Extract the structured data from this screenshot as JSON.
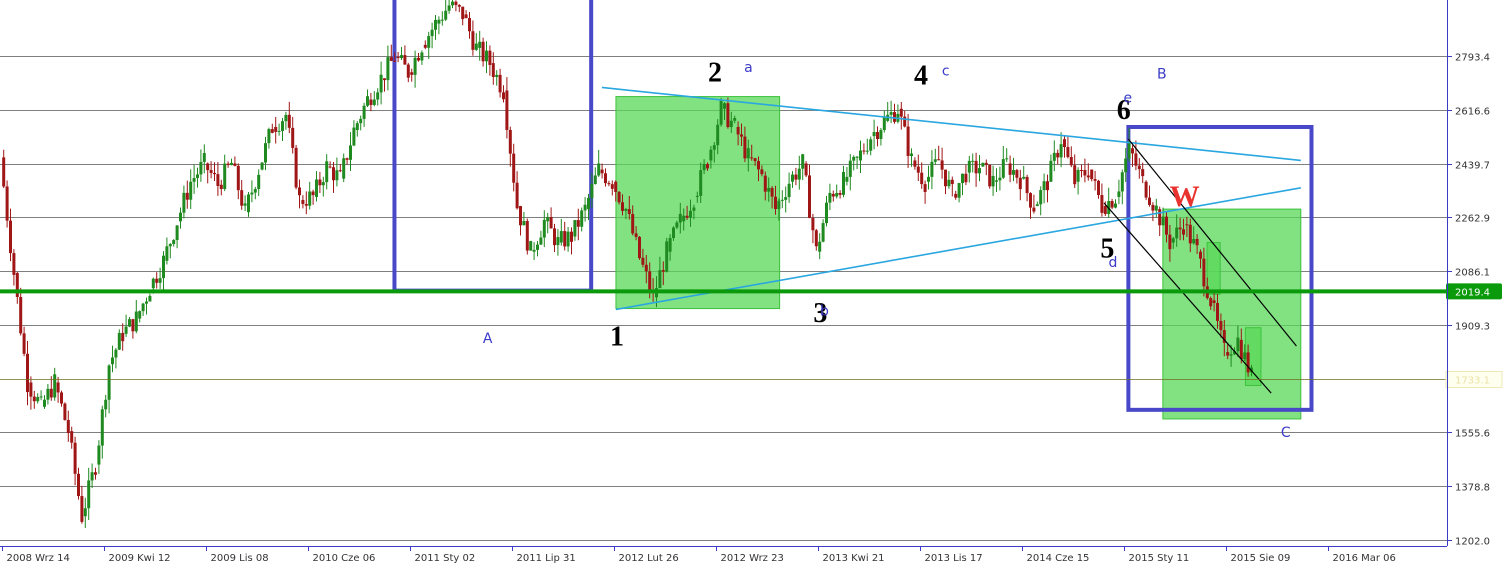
{
  "chart_data": {
    "type": "candlestick",
    "title": "",
    "xlabel": "",
    "ylabel": "",
    "ylim": [
      1202.0,
      3000.0
    ],
    "grid": true,
    "y_ticks": [
      "2793.4",
      "2616.6",
      "2439.7",
      "2262.9",
      "2086.1",
      "1909.3",
      "1555.6",
      "1378.8",
      "1202.0"
    ],
    "x_ticks": [
      "2008 Wrz 14",
      "2009 Kwi 12",
      "2009 Lis 08",
      "2010 Cze 06",
      "2011 Sty 02",
      "2011 Lip 31",
      "2012 Lut 26",
      "2012 Wrz 23",
      "2013 Kwi 21",
      "2013 Lis 17",
      "2014 Cze 15",
      "2015 Sty 11",
      "2015 Sie 09",
      "2016 Mar 06"
    ],
    "support_level": {
      "value": 2019.4,
      "label": "2019.4",
      "color": "#0b9a0b"
    },
    "last_price_level": {
      "value": 1733.0,
      "label": "1733.1"
    },
    "colors": {
      "up": "#1f8a1f",
      "down": "#a01515",
      "trendline": "#2aa6e0",
      "box": "#4848c8",
      "zone": "#58d858"
    },
    "waves": [
      {
        "label": "1",
        "date": "2012 Mar 01",
        "price": 1979
      },
      {
        "label": "2",
        "date": "2012 Sep 23",
        "price": 2650
      },
      {
        "label": "3",
        "date": "2013 Apr 28",
        "price": 2070
      },
      {
        "label": "4",
        "date": "2013 Nov 17",
        "price": 2640
      },
      {
        "label": "5",
        "date": "2014 Dec 14",
        "price": 2250
      },
      {
        "label": "6",
        "date": "2015 Jan 25",
        "price": 2520
      }
    ],
    "wave_letters": [
      "a",
      "b",
      "c",
      "d",
      "e",
      "A",
      "B",
      "C"
    ],
    "wave_w": "W",
    "series": [
      {
        "points": [
          [
            "2008 Sep 14",
            2460
          ],
          [
            "2008 Oct 12",
            2080
          ],
          [
            "2008 Nov 09",
            1720
          ],
          [
            "2008 Dec 07",
            1640
          ],
          [
            "2009 Jan 04",
            1720
          ],
          [
            "2009 Feb 01",
            1560
          ],
          [
            "2009 Mar 01",
            1280
          ],
          [
            "2009 Mar 29",
            1450
          ],
          [
            "2009 Apr 26",
            1780
          ],
          [
            "2009 May 24",
            1880
          ],
          [
            "2009 Jun 21",
            1930
          ],
          [
            "2009 Jul 19",
            2030
          ],
          [
            "2009 Aug 16",
            2120
          ],
          [
            "2009 Sep 13",
            2250
          ],
          [
            "2009 Oct 11",
            2380
          ],
          [
            "2009 Nov 08",
            2440
          ],
          [
            "2009 Dec 06",
            2370
          ],
          [
            "2010 Jan 03",
            2440
          ],
          [
            "2010 Jan 31",
            2280
          ],
          [
            "2010 Feb 28",
            2420
          ],
          [
            "2010 Mar 28",
            2560
          ],
          [
            "2010 Apr 25",
            2600
          ],
          [
            "2010 May 23",
            2320
          ],
          [
            "2010 Jun 20",
            2330
          ],
          [
            "2010 Jul 18",
            2430
          ],
          [
            "2010 Aug 15",
            2390
          ],
          [
            "2010 Sep 12",
            2550
          ],
          [
            "2010 Oct 10",
            2650
          ],
          [
            "2010 Nov 07",
            2720
          ],
          [
            "2010 Dec 05",
            2790
          ],
          [
            "2011 Jan 02",
            2740
          ],
          [
            "2011 Jan 30",
            2830
          ],
          [
            "2011 Feb 27",
            2900
          ],
          [
            "2011 Mar 27",
            2960
          ],
          [
            "2011 Apr 24",
            2930
          ],
          [
            "2011 May 22",
            2820
          ],
          [
            "2011 Jun 19",
            2770
          ],
          [
            "2011 Jul 17",
            2680
          ],
          [
            "2011 Aug 14",
            2300
          ],
          [
            "2011 Sep 11",
            2150
          ],
          [
            "2011 Oct 09",
            2250
          ],
          [
            "2011 Nov 06",
            2180
          ],
          [
            "2011 Dec 04",
            2200
          ],
          [
            "2012 Jan 01",
            2290
          ],
          [
            "2012 Jan 29",
            2420
          ],
          [
            "2012 Feb 26",
            2380
          ],
          [
            "2012 Mar 25",
            2290
          ],
          [
            "2012 Apr 22",
            2130
          ],
          [
            "2012 May 20",
            2000
          ],
          [
            "2012 Jun 17",
            2150
          ],
          [
            "2012 Jul 15",
            2250
          ],
          [
            "2012 Aug 12",
            2330
          ],
          [
            "2012 Sep 09",
            2450
          ],
          [
            "2012 Oct 07",
            2620
          ],
          [
            "2012 Nov 04",
            2560
          ],
          [
            "2012 Dec 02",
            2460
          ],
          [
            "2012 Dec 30",
            2400
          ],
          [
            "2013 Jan 27",
            2290
          ],
          [
            "2013 Feb 24",
            2380
          ],
          [
            "2013 Mar 24",
            2440
          ],
          [
            "2013 Apr 21",
            2150
          ],
          [
            "2013 May 19",
            2340
          ],
          [
            "2013 Jun 16",
            2380
          ],
          [
            "2013 Jul 14",
            2450
          ],
          [
            "2013 Aug 11",
            2530
          ],
          [
            "2013 Sep 08",
            2580
          ],
          [
            "2013 Oct 06",
            2620
          ],
          [
            "2013 Nov 03",
            2450
          ],
          [
            "2013 Dec 01",
            2380
          ],
          [
            "2013 Dec 29",
            2450
          ],
          [
            "2014 Jan 26",
            2340
          ],
          [
            "2014 Feb 23",
            2410
          ],
          [
            "2014 Mar 23",
            2430
          ],
          [
            "2014 Apr 20",
            2380
          ],
          [
            "2014 May 18",
            2440
          ],
          [
            "2014 Jun 15",
            2390
          ],
          [
            "2014 Jul 13",
            2300
          ],
          [
            "2014 Aug 10",
            2380
          ],
          [
            "2014 Sep 07",
            2520
          ],
          [
            "2014 Oct 05",
            2380
          ],
          [
            "2014 Nov 02",
            2420
          ],
          [
            "2014 Nov 30",
            2300
          ],
          [
            "2014 Dec 28",
            2330
          ],
          [
            "2015 Jan 25",
            2490
          ],
          [
            "2015 Feb 22",
            2380
          ],
          [
            "2015 Mar 22",
            2290
          ],
          [
            "2015 Apr 19",
            2180
          ],
          [
            "2015 May 17",
            2240
          ],
          [
            "2015 Jun 14",
            2150
          ],
          [
            "2015 Jul 12",
            1990
          ],
          [
            "2015 Aug 09",
            1820
          ],
          [
            "2015 Sep 06",
            1860
          ],
          [
            "2015 Oct 04",
            1740
          ]
        ]
      }
    ]
  }
}
